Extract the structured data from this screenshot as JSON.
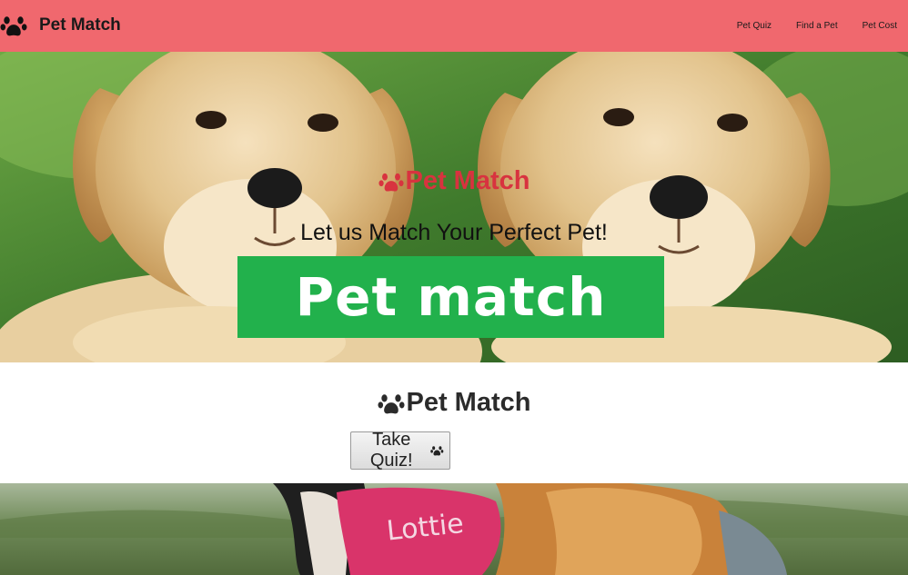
{
  "navbar": {
    "brand": "Pet Match",
    "brand_icon": "paw-icon",
    "links": [
      "Pet Quiz",
      "Find a Pet",
      "Pet Cost"
    ],
    "background": "#f0686e"
  },
  "hero": {
    "title": "Pet Match",
    "title_icon": "paw-icon",
    "title_color": "#d8333f",
    "tagline": "Let us Match Your Perfect Pet!",
    "banner_text": "Pet match",
    "banner_color": "#22b14c",
    "image": "two golden retriever puppies"
  },
  "section": {
    "title": "Pet Match",
    "title_icon": "paw-icon",
    "quiz_button": "Take Quiz!",
    "quiz_button_icon": "paw-icon"
  },
  "bottom_image": {
    "image": "dogs in a field",
    "tag_text": "Lottie"
  }
}
